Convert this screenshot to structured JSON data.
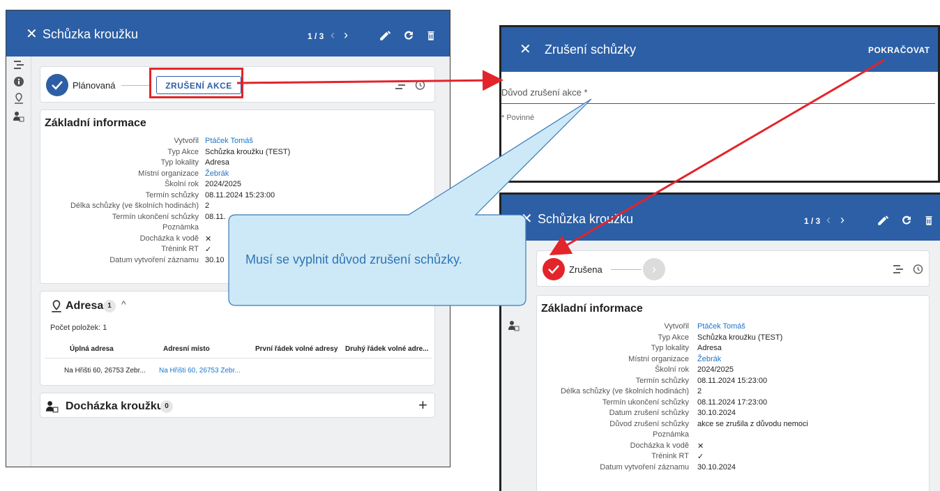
{
  "left": {
    "title": "Schůzka kroužku",
    "pager": "1 / 3",
    "status": {
      "label": "Plánovaná",
      "action_button": "ZRUŠENÍ AKCE"
    },
    "basic_info": {
      "title": "Základní informace",
      "rows": [
        {
          "label": "Vytvořil",
          "value": "Ptáček Tomáš",
          "link": true
        },
        {
          "label": "Typ Akce",
          "value": "Schůzka kroužku (TEST)"
        },
        {
          "label": "Typ lokality",
          "value": "Adresa"
        },
        {
          "label": "Místní organizace",
          "value": "Žebrák",
          "link": true
        },
        {
          "label": "Školní rok",
          "value": "2024/2025"
        },
        {
          "label": "Termín schůzky",
          "value": "08.11.2024 15:23:00"
        },
        {
          "label": "Délka schůzky (ve školních hodinách)",
          "value": "2"
        },
        {
          "label": "Termín ukončení schůzky",
          "value": "08.11."
        },
        {
          "label": "Poznámka",
          "value": ""
        },
        {
          "label": "Docházka k vodě",
          "value": "✕"
        },
        {
          "label": "Trénink RT",
          "value": "✓"
        },
        {
          "label": "Datum vytvoření záznamu",
          "value": "30.10"
        }
      ]
    },
    "address": {
      "title": "Adresa",
      "count": "1",
      "items_count": "Počet položek: 1",
      "columns": [
        "Úplná adresa",
        "Adresní místo",
        "První řádek volné adresy",
        "Druhý řádek volné adre..."
      ],
      "row": [
        "Na Hřišti 60, 26753 Žebr...",
        "Na Hřišti 60, 26753 Žebr...",
        "",
        ""
      ]
    },
    "attendance": {
      "title": "Docházka kroužku",
      "count": "0",
      "add": "+"
    }
  },
  "dialog": {
    "title": "Zrušení schůzky",
    "continue": "POKRAČOVAT",
    "reason_placeholder": "Důvod zrušení akce *",
    "required_note": "* Povinné"
  },
  "right": {
    "title": "Schůzka kroužku",
    "pager": "1 / 3",
    "status": {
      "label": "Zrušena"
    },
    "basic_info": {
      "title": "Základní informace",
      "rows": [
        {
          "label": "Vytvořil",
          "value": "Ptáček Tomáš",
          "link": true
        },
        {
          "label": "Typ Akce",
          "value": "Schůzka kroužku (TEST)"
        },
        {
          "label": "Typ lokality",
          "value": "Adresa"
        },
        {
          "label": "Místní organizace",
          "value": "Žebrák",
          "link": true
        },
        {
          "label": "Školní rok",
          "value": "2024/2025"
        },
        {
          "label": "Termín schůzky",
          "value": "08.11.2024 15:23:00"
        },
        {
          "label": "Délka schůzky (ve školních hodinách)",
          "value": "2"
        },
        {
          "label": "Termín ukončení schůzky",
          "value": "08.11.2024 17:23:00"
        },
        {
          "label": "Datum zrušení schůzky",
          "value": "30.10.2024"
        },
        {
          "label": "Důvod zrušení schůzky",
          "value": "akce se zrušila z důvodu nemoci"
        },
        {
          "label": "Poznámka",
          "value": ""
        },
        {
          "label": "Docházka k vodě",
          "value": "✕"
        },
        {
          "label": "Trénink RT",
          "value": "✓"
        },
        {
          "label": "Datum vytvoření záznamu",
          "value": "30.10.2024"
        }
      ]
    }
  },
  "callout": {
    "text": "Musí se vyplnit důvod zrušení schůzky."
  },
  "colors": {
    "header": "#2c5fa5",
    "accent_red": "#e3242b",
    "link": "#1d74c9",
    "callout_fill": "#cde8f6"
  },
  "icons": [
    "close-icon",
    "chevron-left-icon",
    "chevron-right-icon",
    "pencil-icon",
    "refresh-icon",
    "trash-icon",
    "check-icon",
    "workflow-icon",
    "history-icon",
    "info-icon",
    "map-pin-icon",
    "person-check-icon",
    "chevron-up-icon"
  ]
}
